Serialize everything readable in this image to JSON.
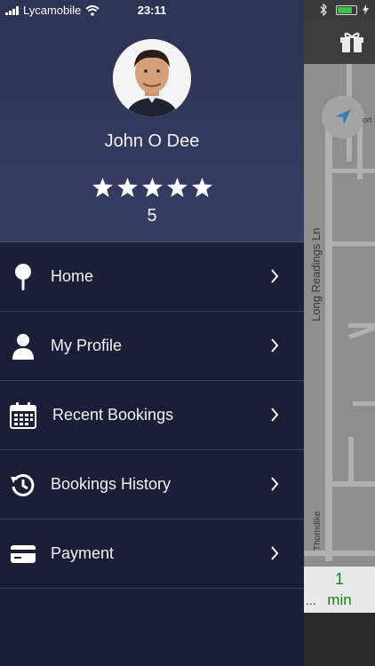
{
  "status": {
    "carrier": "Lycamobile",
    "time": "23:11"
  },
  "profile": {
    "name": "John O Dee",
    "stars": 5,
    "rating": "5"
  },
  "menu": {
    "items": [
      {
        "label": "Home",
        "icon": "pin-icon"
      },
      {
        "label": "My Profile",
        "icon": "user-icon"
      },
      {
        "label": "Recent Bookings",
        "icon": "calendar-icon"
      },
      {
        "label": "Bookings History",
        "icon": "history-icon"
      },
      {
        "label": "Payment",
        "icon": "credit-card-icon"
      }
    ]
  },
  "map": {
    "street_main": "Long Readings Ln",
    "street_lower": "Thorndike",
    "street_fragment": "ort",
    "eta_value": "1",
    "eta_unit": "min",
    "eta_prefix": "..."
  },
  "colors": {
    "drawer_bg": "#1b1e36",
    "header_bg": "#383d66",
    "eta_text": "#1f7a1f",
    "battery": "#3cc14a"
  }
}
